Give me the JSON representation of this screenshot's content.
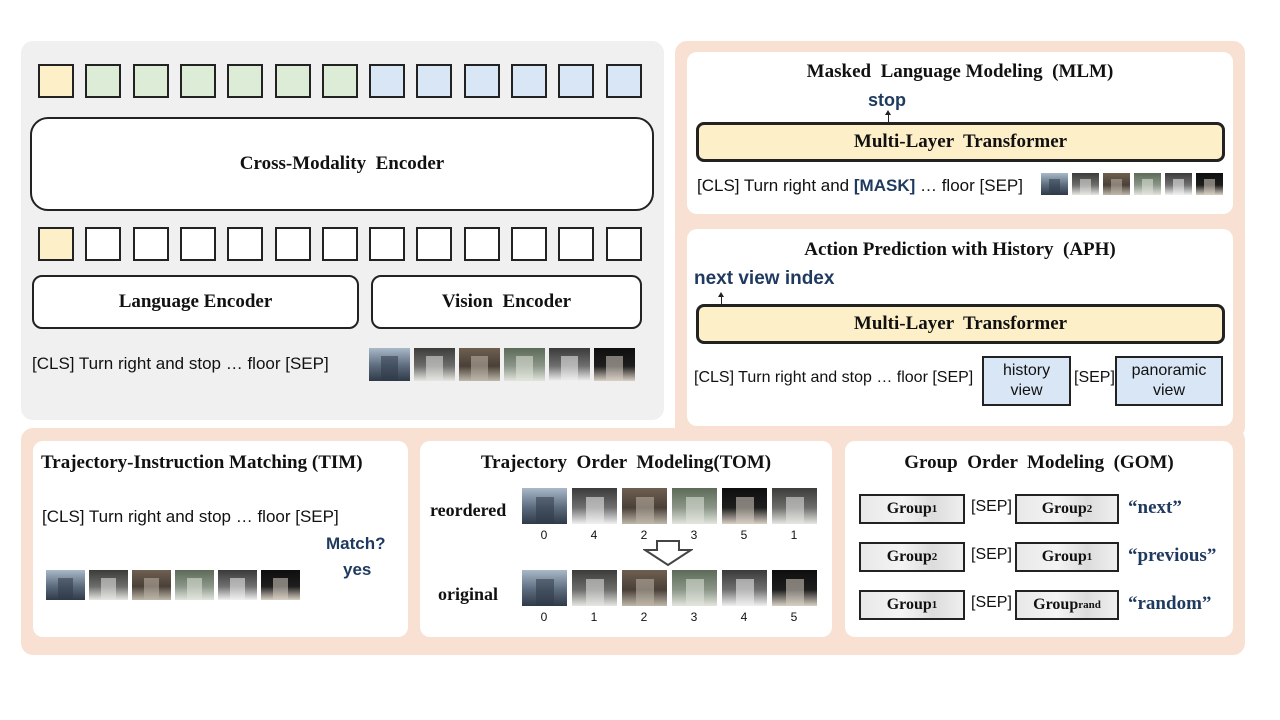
{
  "left_panel": {
    "cross_encoder_label": "Cross-Modality  Encoder",
    "language_encoder_label": "Language Encoder",
    "vision_encoder_label": "Vision  Encoder",
    "sequence_text": "[CLS] Turn right and stop … floor [SEP]",
    "output_token_colors": [
      "yellow",
      "green",
      "green",
      "green",
      "green",
      "green",
      "green",
      "blue",
      "blue",
      "blue",
      "blue",
      "blue",
      "blue"
    ],
    "input_token_colors": [
      "yellow",
      "white",
      "white",
      "white",
      "white",
      "white",
      "white",
      "white",
      "white",
      "white",
      "white",
      "white",
      "white"
    ]
  },
  "mlm": {
    "title": "Masked  Language Modeling  (MLM)",
    "output_word": "stop",
    "transformer_label": "Multi-Layer  Transformer",
    "seq_prefix": "[CLS] Turn right and ",
    "mask_token": "[MASK]",
    "seq_suffix": " … floor [SEP]"
  },
  "aph": {
    "title": "Action Prediction with History  (APH)",
    "output_label": "next view index",
    "transformer_label": "Multi-Layer  Transformer",
    "sequence_text": "[CLS] Turn right and stop … floor [SEP]",
    "history_line1": "history",
    "history_line2": "view",
    "sep_text": "[SEP]",
    "panoramic_line1": "panoramic",
    "panoramic_line2": "view"
  },
  "tim": {
    "title": "Trajectory-Instruction Matching (TIM)",
    "sequence_text": "[CLS] Turn right and stop … floor [SEP]",
    "question": "Match?",
    "answer": "yes"
  },
  "tom": {
    "title": "Trajectory  Order  Modeling(TOM)",
    "reordered_label": "reordered",
    "original_label": "original",
    "reordered_indices": [
      "0",
      "4",
      "2",
      "3",
      "5",
      "1"
    ],
    "original_indices": [
      "0",
      "1",
      "2",
      "3",
      "4",
      "5"
    ]
  },
  "gom": {
    "title": "Group  Order  Modeling  (GOM)",
    "sep_text": "[SEP]",
    "rows": [
      {
        "left_base": "Group",
        "left_sub": "1",
        "right_base": "Group",
        "right_sub": "2",
        "label": "“next”"
      },
      {
        "left_base": "Group",
        "left_sub": "2",
        "right_base": "Group",
        "right_sub": "1",
        "label": "“previous”"
      },
      {
        "left_base": "Group",
        "left_sub": "1",
        "right_base": "Group",
        "right_sub": "rand",
        "label": "“random”"
      }
    ]
  },
  "colors": {
    "token_yellow": "#fdf0c8",
    "token_green": "#dcecd6",
    "token_blue": "#d9e6f5",
    "panel_gray": "#f0f0f0",
    "panel_peach": "#f8e1d3",
    "accent_text": "#1f3a5f"
  }
}
